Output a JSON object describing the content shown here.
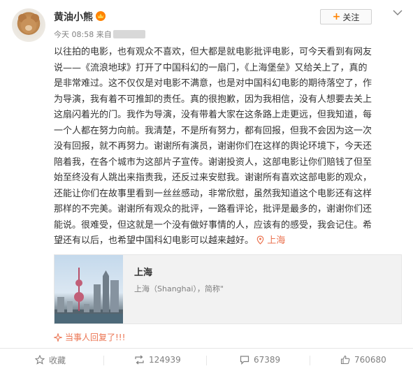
{
  "post": {
    "username": "黄油小熊",
    "time": "今天 08:58 来自",
    "follow_label": "关注",
    "content_lines": [
      "以往拍的电影，也有观众不喜欢，但大都是就电影批评电影，可今天看到有网友",
      "说——《流浪地球》打开了中国科幻的一扇门，《上海堡垒》又给关上了，真的",
      "是非常难过。这不仅仅是对电影不满意，也是对中国科幻电影的期待落空了，作",
      "为导演，我有着不可推卸的责任。真的很抱歉，因为我相信，没有人想要去关上",
      "这扇闪着光的门。我作为导演，没有带着大家在这条路上走更远，但我知道，每",
      "一个人都在努力向前。我清楚，不是所有努力，都有回报，但我不会因为这一次",
      "没有回报，就不再努力。谢谢所有演员，谢谢你们在这样的舆论环境下，今天还",
      "陪着我，在各个城市为这部片子宣传。谢谢投资人，这部电影让你们赔钱了但至",
      "始至终没有人跳出来指责我，还反过来安慰我。谢谢所有喜欢这部电影的观众，",
      "还能让你们在故事里看到一丝丝感动，非常欣慰，虽然我知道这个电影还有这样",
      "那样的不完美。谢谢所有观众的批评，一路看评论，批评是最多的，谢谢你们还",
      "能说。很难受，但这就是一个没有做好事情的人，应该有的感受，我会记住。希"
    ],
    "last_line": "望还有以后，也希望中国科幻电影可以越来越好。",
    "location_tag": "上海"
  },
  "card": {
    "title": "上海",
    "description": "上海（Shanghai），简称\""
  },
  "reply_text": "当事人回复了!!!",
  "actions": {
    "favorite": "收藏",
    "repost": "124939",
    "comment": "67389",
    "like": "760680"
  },
  "colors": {
    "accent": "#ff8200",
    "link": "#eb7350",
    "muted": "#808080"
  },
  "icons": [
    "vip-crown-icon",
    "plus-icon",
    "chevron-down-icon",
    "location-pin-icon",
    "sparkle-icon",
    "star-icon",
    "repost-icon",
    "comment-icon",
    "thumbs-up-icon"
  ]
}
